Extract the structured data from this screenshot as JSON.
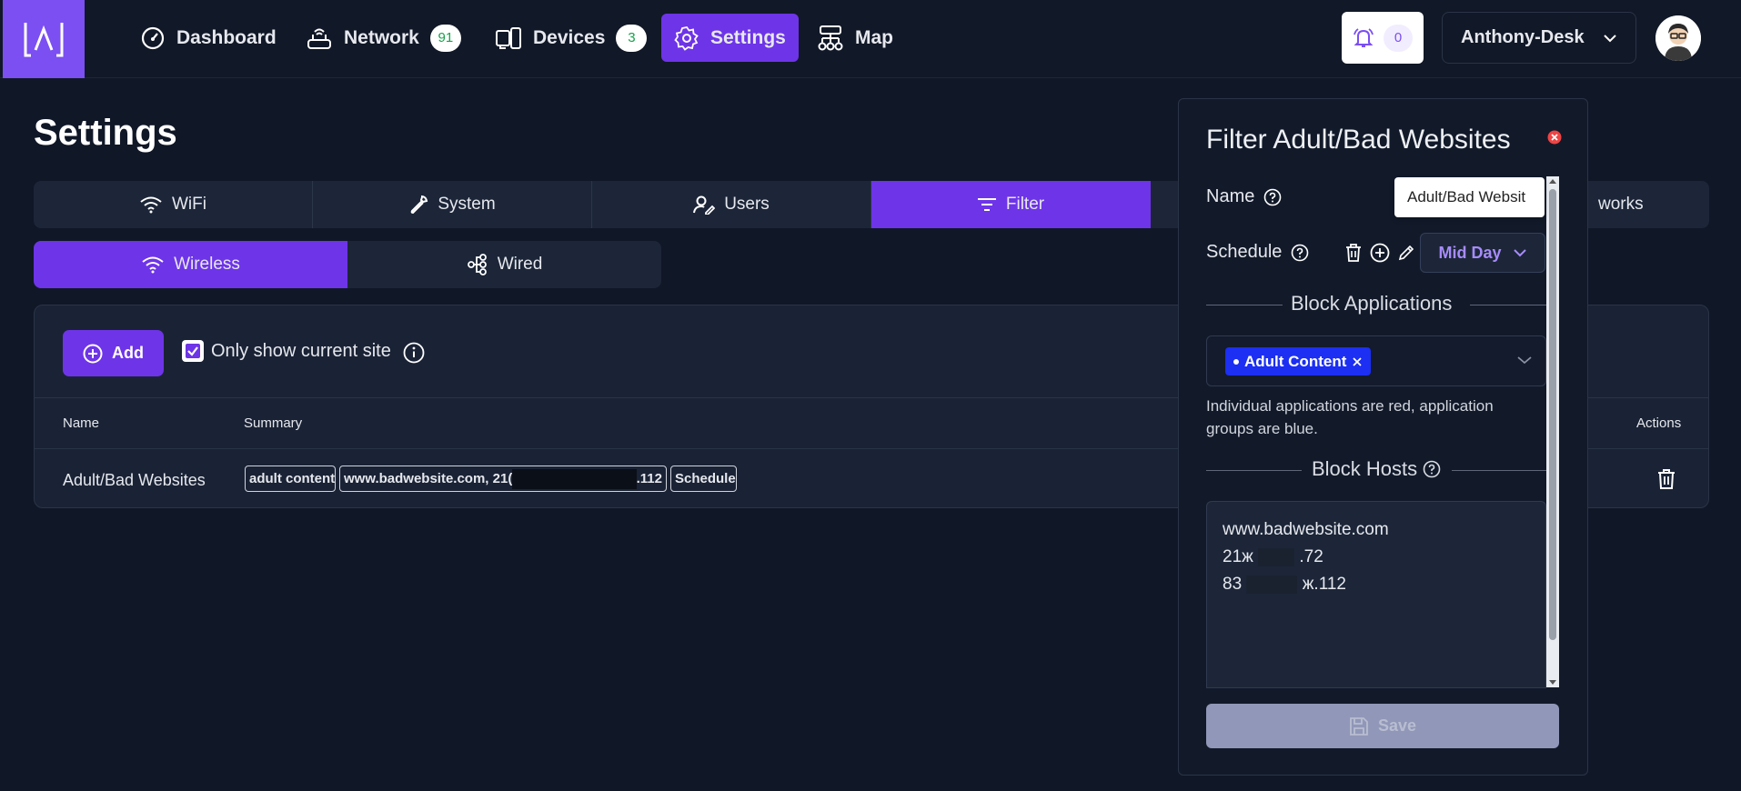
{
  "nav": {
    "items": [
      {
        "label": "Dashboard"
      },
      {
        "label": "Network",
        "badge": "91"
      },
      {
        "label": "Devices",
        "badge": "3"
      },
      {
        "label": "Settings"
      },
      {
        "label": "Map"
      }
    ],
    "notifications_count": "0",
    "site_name": "Anthony-Desk"
  },
  "page": {
    "title": "Settings",
    "tabs": [
      {
        "label": "WiFi"
      },
      {
        "label": "System"
      },
      {
        "label": "Users"
      },
      {
        "label": "Filter"
      },
      {
        "label": ""
      },
      {
        "label": "works"
      }
    ],
    "subtabs": [
      {
        "label": "Wireless"
      },
      {
        "label": "Wired"
      }
    ],
    "add_label": "Add",
    "only_current_label": "Only show current site",
    "table": {
      "headers": {
        "name": "Name",
        "summary": "Summary",
        "actions": "Actions"
      },
      "rows": [
        {
          "name": "Adult/Bad Websites",
          "chips": {
            "apps": "adult content",
            "hosts_start": "www.badwebsite.com, 21(",
            "hosts_end": ".112",
            "schedule": "Schedule"
          }
        }
      ]
    }
  },
  "drawer": {
    "title": "Filter Adult/Bad Websites",
    "name_label": "Name",
    "name_value": "Adult/Bad Websit",
    "schedule_label": "Schedule",
    "schedule_value": "Mid Day",
    "block_apps_title": "Block Applications",
    "app_tag": "Adult Content",
    "hint": "Individual applications are red, application groups are blue.",
    "block_hosts_title": "Block Hosts",
    "hosts": [
      {
        "start": "www.badwebsite.com",
        "end": ""
      },
      {
        "start": "21ж",
        "end": ".72"
      },
      {
        "start": "83",
        "end": "ж.112"
      }
    ],
    "save_label": "Save"
  },
  "colors": {
    "accent": "#6e34e8",
    "background": "#101727",
    "app_tag": "#1c2ff2",
    "close": "#ef4444",
    "badge_text": "#16a34a"
  }
}
